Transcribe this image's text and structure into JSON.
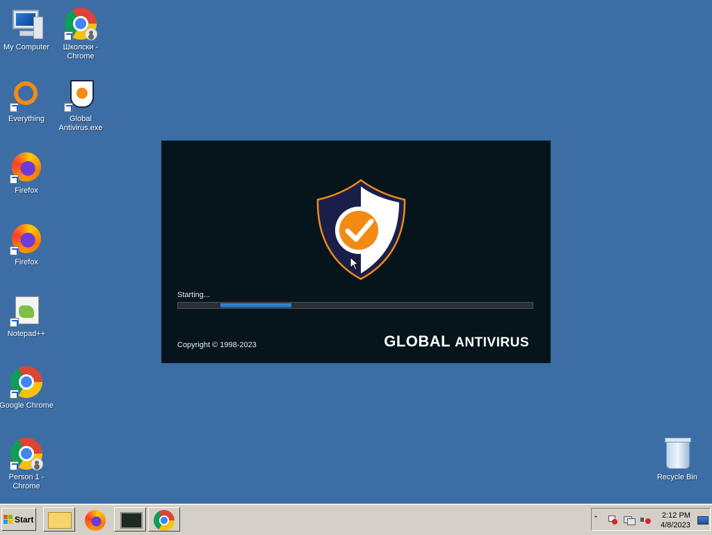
{
  "desktop": {
    "icons": [
      {
        "label": "My Computer",
        "icon": "my-computer-icon"
      },
      {
        "label": "Школски - Chrome",
        "icon": "chrome-icon"
      },
      {
        "label": "Everything",
        "icon": "everything-icon"
      },
      {
        "label": "Global Antivirus.exe",
        "icon": "global-antivirus-icon"
      },
      {
        "label": "Firefox",
        "icon": "firefox-icon"
      },
      {
        "label": "Firefox",
        "icon": "firefox-icon"
      },
      {
        "label": "Notepad++",
        "icon": "notepad-plus-plus-icon"
      },
      {
        "label": "Google Chrome",
        "icon": "chrome-icon"
      },
      {
        "label": "Person 1 - Chrome",
        "icon": "chrome-icon"
      },
      {
        "label": "Recycle Bin",
        "icon": "recycle-bin-icon"
      }
    ]
  },
  "splash": {
    "status": "Starting...",
    "progress_fraction": 0.2,
    "copyright": "Copyright © 1998-2023",
    "brand_part1": "GLOBAL",
    "brand_part2": "ANTIVIRUS",
    "colors": {
      "background": "#06141c",
      "accent": "#f28a14",
      "shield_dark": "#1a1f4a",
      "progress": "#2a7fd0"
    }
  },
  "taskbar": {
    "start_label": "Start",
    "clock_time": "2:12 PM",
    "clock_date": "4/8/2023",
    "pinned": [
      "file-explorer-icon",
      "firefox-icon",
      "task-manager-icon",
      "chrome-icon"
    ],
    "tray_icons": [
      "show-hidden-icons",
      "action-center-flag-icon",
      "network-icon",
      "volume-muted-icon",
      "show-desktop-icon"
    ]
  }
}
